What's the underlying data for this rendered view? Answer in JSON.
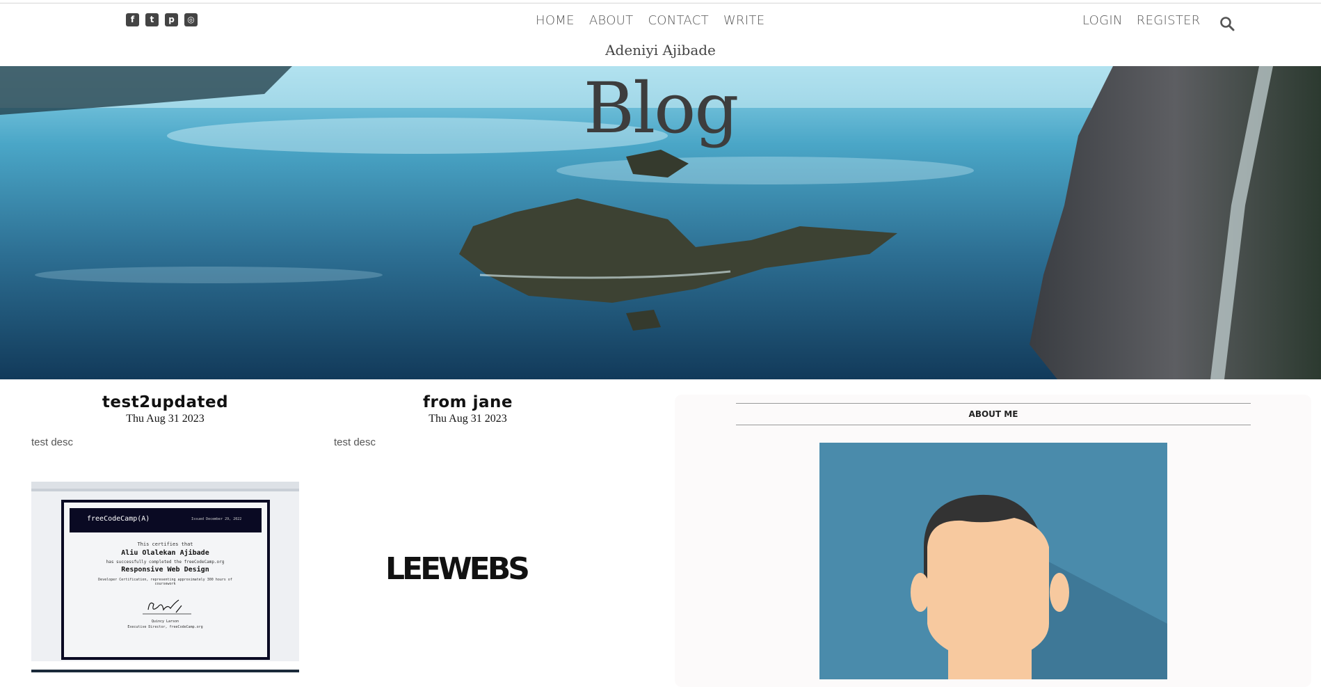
{
  "topbar": {
    "social": [
      "facebook-icon",
      "twitter-icon",
      "pinterest-icon",
      "instagram-icon"
    ],
    "nav": [
      "HOME",
      "ABOUT",
      "CONTACT",
      "WRITE"
    ],
    "auth": [
      "LOGIN",
      "REGISTER"
    ],
    "search_icon": "search-icon"
  },
  "site_name": "Adeniyi Ajibade",
  "hero": {
    "title": "Blog"
  },
  "posts": [
    {
      "title": "test2updated",
      "date": "Thu Aug 31 2023",
      "desc": "test desc",
      "cert": {
        "brand": "freeCodeCamp(A)",
        "issued": "Issued December 29, 2022",
        "certifies": "This certifies that",
        "name": "Aliu Olalekan Ajibade",
        "completed": "has successfully completed the freeCodeCamp.org",
        "course": "Responsive Web Design",
        "hours": "Developer Certification, representing approximately 300 hours of coursework",
        "signer": "Quincy Larson",
        "role": "Executive Director, freeCodeCamp.org"
      }
    },
    {
      "title": "from jane",
      "date": "Thu Aug 31 2023",
      "desc": "test desc",
      "logo": "LEEWEBS"
    }
  ],
  "sidebar": {
    "heading": "ABOUT ME"
  },
  "colors": {
    "accent": "#444444",
    "hero_water": "#3a8fb0",
    "avatar_bg": "#4a8bab"
  }
}
